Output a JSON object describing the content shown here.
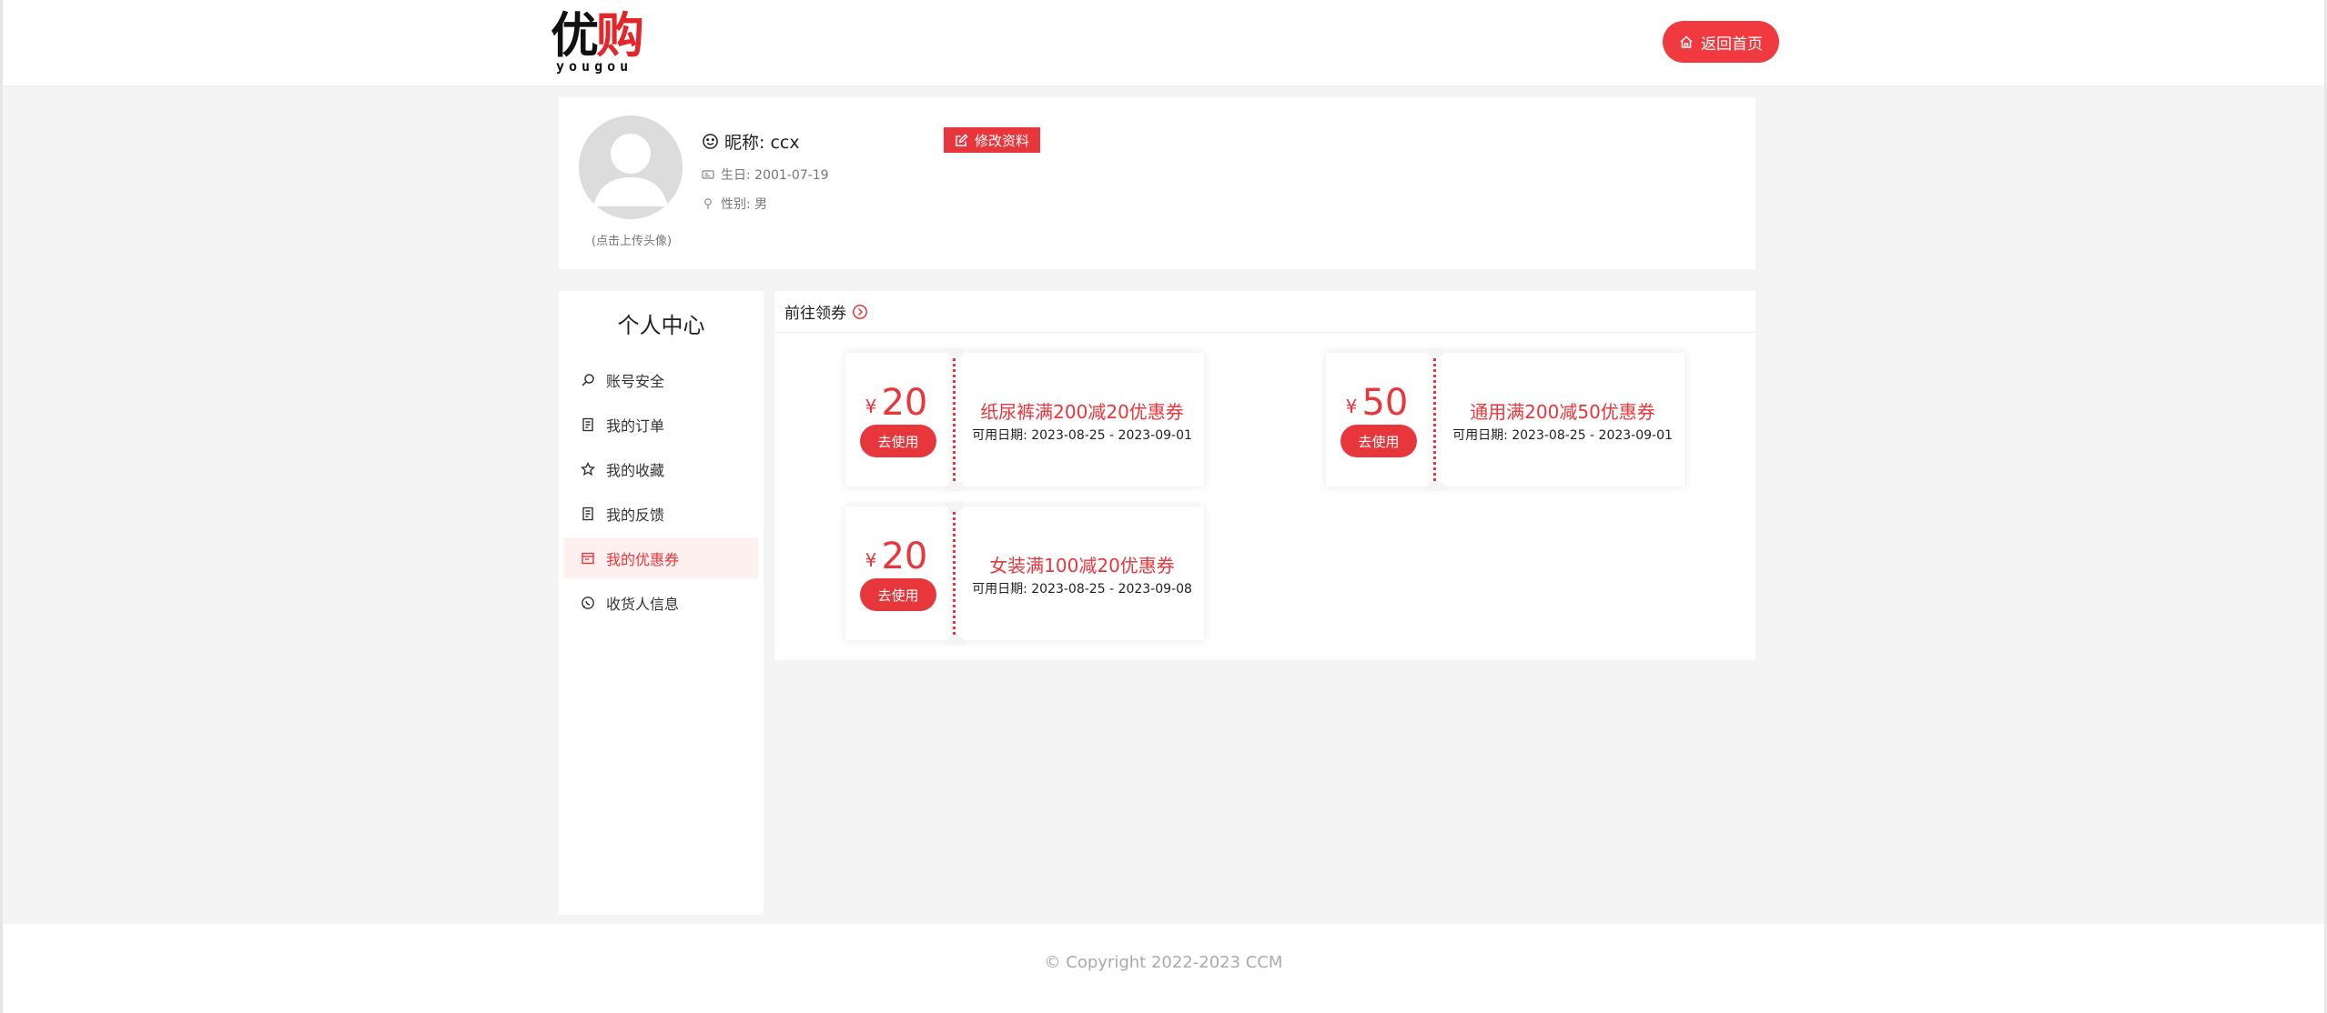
{
  "header": {
    "logo_cn_1": "优",
    "logo_cn_2": "购",
    "logo_en": "yougou",
    "home_label": "返回首页"
  },
  "profile": {
    "avatar_tip": "(点击上传头像)",
    "nickname": "昵称: ccx",
    "edit_label": "修改资料",
    "birthday": "生日: 2001-07-19",
    "gender": "性别: 男"
  },
  "sidebar": {
    "title": "个人中心",
    "items": [
      {
        "label": "账号安全",
        "icon": "search-icon"
      },
      {
        "label": "我的订单",
        "icon": "document-icon"
      },
      {
        "label": "我的收藏",
        "icon": "star-icon"
      },
      {
        "label": "我的反馈",
        "icon": "document-icon"
      },
      {
        "label": "我的优惠券",
        "icon": "ticket-icon",
        "active": true
      },
      {
        "label": "收货人信息",
        "icon": "chat-icon"
      }
    ]
  },
  "main": {
    "head_label": "前往领券",
    "coupons": [
      {
        "currency": "¥",
        "amount": "20",
        "use_label": "去使用",
        "name": "纸尿裤满200减20优惠券",
        "date": "可用日期: 2023-08-25 - 2023-09-01"
      },
      {
        "currency": "¥",
        "amount": "50",
        "use_label": "去使用",
        "name": "通用满200减50优惠券",
        "date": "可用日期: 2023-08-25 - 2023-09-01"
      },
      {
        "currency": "¥",
        "amount": "20",
        "use_label": "去使用",
        "name": "女装满100减20优惠券",
        "date": "可用日期: 2023-08-25 - 2023-09-08"
      }
    ]
  },
  "footer": {
    "copyright": "© Copyright 2022-2023 CCM"
  },
  "colors": {
    "accent": "#e8373c",
    "background": "#f4f4f4"
  }
}
